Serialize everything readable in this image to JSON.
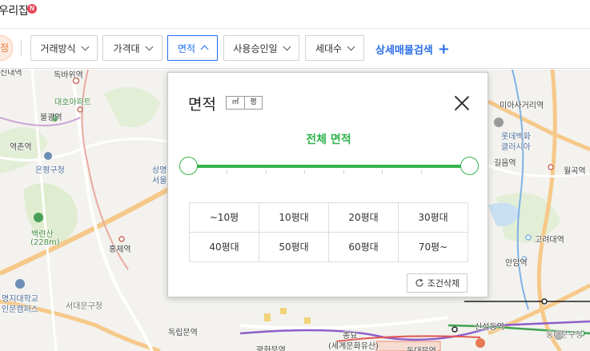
{
  "header": {
    "title": "우리집",
    "badge": "N"
  },
  "filters": {
    "left_chip": "정",
    "items": [
      {
        "label": "거래방식"
      },
      {
        "label": "가격대"
      },
      {
        "label": "면적",
        "active": true
      },
      {
        "label": "사용승인일"
      },
      {
        "label": "세대수"
      }
    ],
    "advanced_label": "상세매물검색",
    "advanced_icon": "plus-icon"
  },
  "popup": {
    "title": "면적",
    "unit_m2": "㎡",
    "unit_pyeong": "평",
    "range_label": "전체 면적",
    "options": [
      "~10평",
      "10평대",
      "20평대",
      "30평대",
      "40평대",
      "50평대",
      "60평대",
      "70평~"
    ],
    "reset_label": "조건삭제",
    "reset_icon": "refresh-icon"
  },
  "map": {
    "labels": [
      {
        "text": "신내역",
        "cls": ""
      },
      {
        "text": "독바위역",
        "cls": ""
      },
      {
        "text": "대호아파트",
        "cls": "green"
      },
      {
        "text": "불광역",
        "cls": ""
      },
      {
        "text": "역촌역",
        "cls": ""
      },
      {
        "text": "은평구청",
        "cls": "blue"
      },
      {
        "text": "백련산",
        "cls": "green"
      },
      {
        "text": "(228m)",
        "cls": "green"
      },
      {
        "text": "홍제역",
        "cls": ""
      },
      {
        "text": "명지대학교",
        "cls": "blue"
      },
      {
        "text": "인문캠퍼스",
        "cls": "blue"
      },
      {
        "text": "서대문구청",
        "cls": "gray"
      },
      {
        "text": "독립문역",
        "cls": ""
      },
      {
        "text": "광화문역",
        "cls": ""
      },
      {
        "text": "종묘",
        "cls": ""
      },
      {
        "text": "(세계문화유산)",
        "cls": ""
      },
      {
        "text": "동대문역",
        "cls": ""
      },
      {
        "text": "신설동역",
        "cls": ""
      },
      {
        "text": "동대문구청",
        "cls": "gray"
      },
      {
        "text": "안암역",
        "cls": ""
      },
      {
        "text": "고려대역",
        "cls": ""
      },
      {
        "text": "월곡역",
        "cls": ""
      },
      {
        "text": "미아사거리역",
        "cls": ""
      },
      {
        "text": "롯데백화",
        "cls": "blue"
      },
      {
        "text": "클러시아",
        "cls": "blue"
      },
      {
        "text": "길음역",
        "cls": ""
      },
      {
        "text": "상명",
        "cls": "blue"
      },
      {
        "text": "서울",
        "cls": "blue"
      }
    ]
  }
}
